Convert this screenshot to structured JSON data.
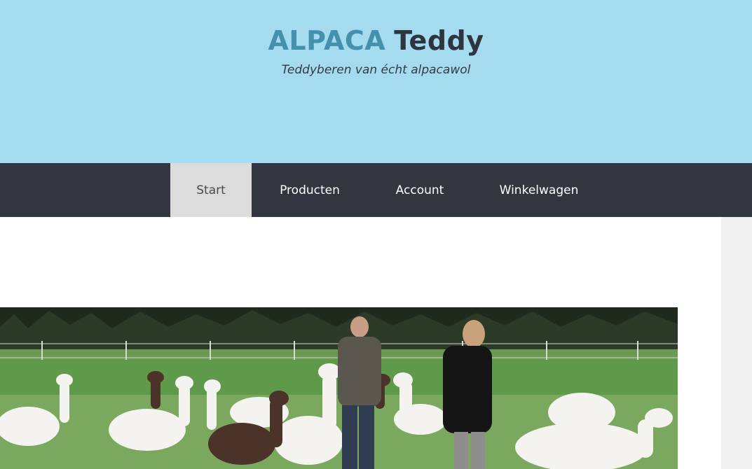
{
  "site": {
    "logo_part1": "ALPACA",
    "logo_part2": "Teddy",
    "tagline": "Teddyberen van écht alpacawol"
  },
  "nav": {
    "items": [
      {
        "label": "Start",
        "active": true
      },
      {
        "label": "Producten",
        "active": false
      },
      {
        "label": "Account",
        "active": false
      },
      {
        "label": "Winkelwagen",
        "active": false
      }
    ]
  },
  "colors": {
    "header_bg": "#a4dbee",
    "logo_accent": "#4590ad",
    "nav_bg": "#32373f",
    "nav_active_bg": "#dcdcdc"
  }
}
